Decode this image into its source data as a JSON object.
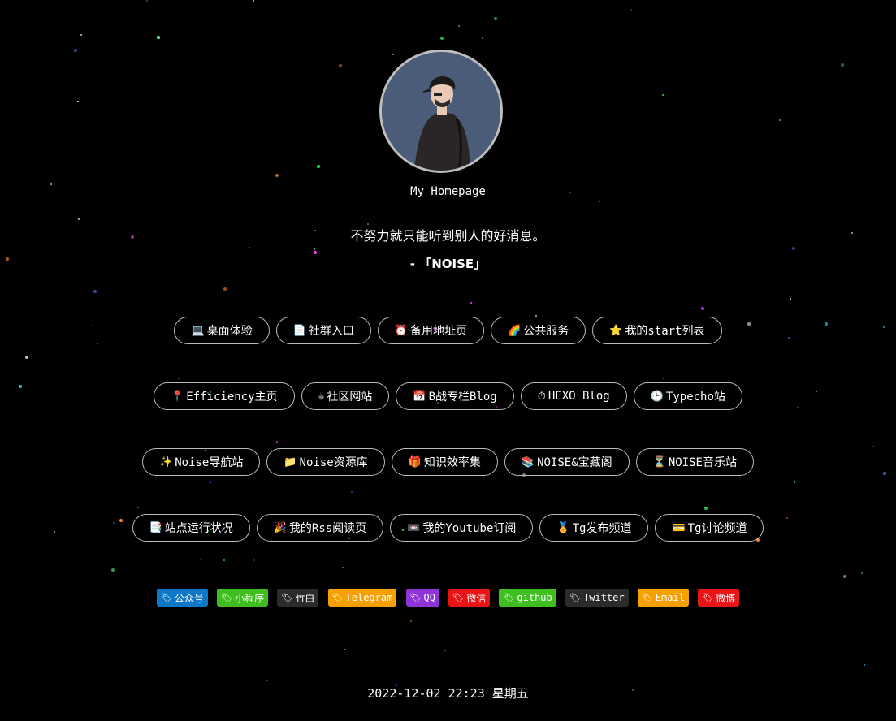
{
  "site": {
    "title": "My Homepage",
    "motto": "不努力就只能听到别人的好消息。",
    "motto_author": "- 「NOISE」"
  },
  "rows": [
    [
      {
        "icon": "💻",
        "label": "桌面体验"
      },
      {
        "icon": "📄",
        "label": "社群入口"
      },
      {
        "icon": "⏰",
        "label": "备用地址页"
      },
      {
        "icon": "🌈",
        "label": "公共服务"
      },
      {
        "icon": "⭐",
        "label": "我的start列表"
      }
    ],
    [
      {
        "icon": "📍",
        "label": "Efficiency主页"
      },
      {
        "icon": "☕",
        "label": "社区网站"
      },
      {
        "icon": "📅",
        "label": "B战专栏Blog"
      },
      {
        "icon": "⏱",
        "label": "HEXO Blog"
      },
      {
        "icon": "🕒",
        "label": "Typecho站"
      }
    ],
    [
      {
        "icon": "✨",
        "label": "Noise导航站"
      },
      {
        "icon": "📁",
        "label": "Noise资源库"
      },
      {
        "icon": "🎁",
        "label": "知识效率集"
      },
      {
        "icon": "📚",
        "label": "NOISE&宝藏阁"
      },
      {
        "icon": "⏳",
        "label": "NOISE音乐站"
      }
    ],
    [
      {
        "icon": "📑",
        "label": "站点运行状况"
      },
      {
        "icon": "🎉",
        "label": "我的Rss阅读页"
      },
      {
        "icon": "📼",
        "label": "我的Youtube订阅"
      },
      {
        "icon": "🏅",
        "label": "Tg发布频道"
      },
      {
        "icon": "💳",
        "label": "Tg讨论频道"
      }
    ]
  ],
  "badges": [
    {
      "label": "公众号",
      "color": "#0e77c7"
    },
    {
      "label": "小程序",
      "color": "#3fbf1f"
    },
    {
      "label": "竹白",
      "color": "#2b2b2b"
    },
    {
      "label": "Telegram",
      "color": "#f5a000"
    },
    {
      "label": "QQ",
      "color": "#8f35d8"
    },
    {
      "label": "微信",
      "color": "#e81416"
    },
    {
      "label": "github",
      "color": "#3fbf1f"
    },
    {
      "label": "Twitter",
      "color": "#2b2b2b"
    },
    {
      "label": "Email",
      "color": "#f5a000"
    },
    {
      "label": "微博",
      "color": "#e81416"
    }
  ],
  "badge_tag_icon": "label-tag-icon",
  "separator": "-",
  "clock": "2022-12-02 22:23 星期五"
}
